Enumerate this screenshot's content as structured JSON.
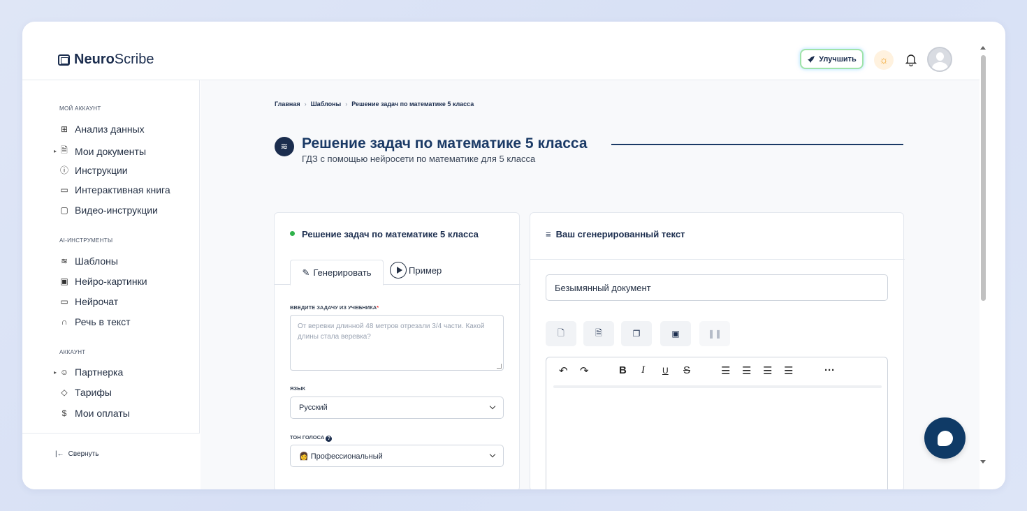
{
  "header": {
    "logo_bold": "Neuro",
    "logo_rest": "Scribe",
    "upgrade_label": "Улучшить"
  },
  "sidebar": {
    "sections": [
      {
        "title": "МОЙ АККАУНТ"
      },
      {
        "title": "AI-ИНСТРУМЕНТЫ"
      },
      {
        "title": "АККАУНТ"
      }
    ],
    "items": [
      {
        "label": "Анализ данных",
        "icon": "grid-icon"
      },
      {
        "label": "Мои документы",
        "icon": "document-icon"
      },
      {
        "label": "Инструкции",
        "icon": "help-circle-icon"
      },
      {
        "label": "Интерактивная книга",
        "icon": "book-icon"
      },
      {
        "label": "Видео-инструкции",
        "icon": "video-icon"
      },
      {
        "label": "Шаблоны",
        "icon": "layers-icon"
      },
      {
        "label": "Нейро-картинки",
        "icon": "image-icon"
      },
      {
        "label": "Нейрочат",
        "icon": "chat-icon"
      },
      {
        "label": "Речь в текст",
        "icon": "headphones-icon"
      },
      {
        "label": "Партнерка",
        "icon": "users-icon"
      },
      {
        "label": "Тарифы",
        "icon": "tag-icon"
      },
      {
        "label": "Мои оплаты",
        "icon": "dollar-icon"
      }
    ],
    "collapse_label": "Свернуть"
  },
  "breadcrumb": [
    "Главная",
    "Шаблоны",
    "Решение задач по математике 5 класса"
  ],
  "page": {
    "title": "Решение задач по математике 5 класса",
    "subtitle": "ГДЗ с помощью нейросети по математике для 5 класса"
  },
  "left_card": {
    "title": "Решение задач по математике 5 класса",
    "tab_generate": "Генерировать",
    "tab_example": "Пример",
    "task_label": "ВВЕДИТЕ ЗАДАЧУ ИЗ УЧЕБНИКА",
    "task_required": "*",
    "task_placeholder": "От веревки длинной 48 метров отрезали 3/4 части. Какой длины стала веревка?",
    "lang_label": "ЯЗЫК",
    "lang_value": "Русский",
    "tone_label": "ТОН ГОЛОСА",
    "tone_value": "👩 Профессиональный"
  },
  "right_card": {
    "title": "Ваш сгенерированный текст",
    "doc_name": "Безымянный документ"
  },
  "colors": {
    "brand": "#1b2d4e",
    "accent_title": "#1b3a66",
    "status_green": "#2fb24b",
    "chat_bubble": "#0f3a66"
  }
}
